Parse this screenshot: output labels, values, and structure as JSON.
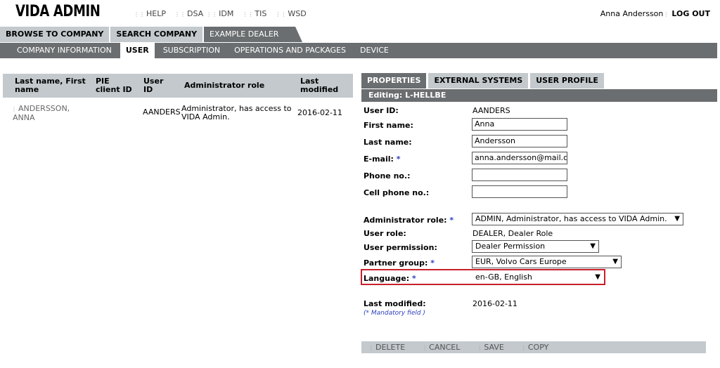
{
  "header": {
    "logo": "VIDA ADMIN",
    "links": [
      "HELP",
      "DSA",
      "IDM",
      "TIS",
      "WSD"
    ],
    "user_name": "Anna Andersson",
    "logout": "LOG OUT"
  },
  "nav": {
    "primary_tabs": [
      "BROWSE TO COMPANY",
      "SEARCH COMPANY",
      "EXAMPLE DEALER"
    ],
    "secondary_tabs": [
      "COMPANY INFORMATION",
      "USER",
      "SUBSCRIPTION",
      "OPERATIONS AND PACKAGES",
      "DEVICE"
    ]
  },
  "user_table": {
    "headers": {
      "name": [
        "Last name, First",
        "name"
      ],
      "pie": [
        "PIE",
        "client ID"
      ],
      "userid": [
        "User",
        "ID"
      ],
      "role": "Administrator role",
      "modified": [
        "Last",
        "modified"
      ]
    },
    "rows": [
      {
        "name": [
          "ANDERSSON,",
          "ANNA"
        ],
        "pie": "",
        "userid": "AANDERS",
        "role": [
          "Administrator, has access to",
          "VIDA Admin."
        ],
        "modified": "2016-02-11"
      }
    ]
  },
  "detail": {
    "tabs": [
      "PROPERTIES",
      "EXTERNAL SYSTEMS",
      "USER PROFILE"
    ],
    "editing": "Editing: L-HELLBE",
    "labels": {
      "user_id": "User ID:",
      "first_name": "First name:",
      "last_name": "Last name:",
      "email": "E-mail:",
      "phone": "Phone no.:",
      "cell": "Cell phone no.:",
      "admin_role": "Administrator role:",
      "user_role": "User role:",
      "user_permission": "User permission:",
      "partner_group": "Partner group:",
      "language": "Language:",
      "last_modified": "Last modified:"
    },
    "required_mark": "*",
    "values": {
      "user_id": "AANDERS",
      "first_name": "Anna",
      "last_name": "Andersson",
      "email": "anna.andersson@mail.co",
      "phone": "",
      "cell": "",
      "admin_role": "ADMIN, Administrator, has access to VIDA Admin.",
      "user_role": "DEALER, Dealer Role",
      "user_permission": "Dealer Permission",
      "partner_group": "EUR, Volvo Cars Europe",
      "language": "en-GB, English",
      "last_modified": "2016-02-11"
    },
    "mandatory_note": "(* Mandatory field )"
  },
  "actions": [
    "DELETE",
    "CANCEL",
    "SAVE",
    "COPY"
  ]
}
